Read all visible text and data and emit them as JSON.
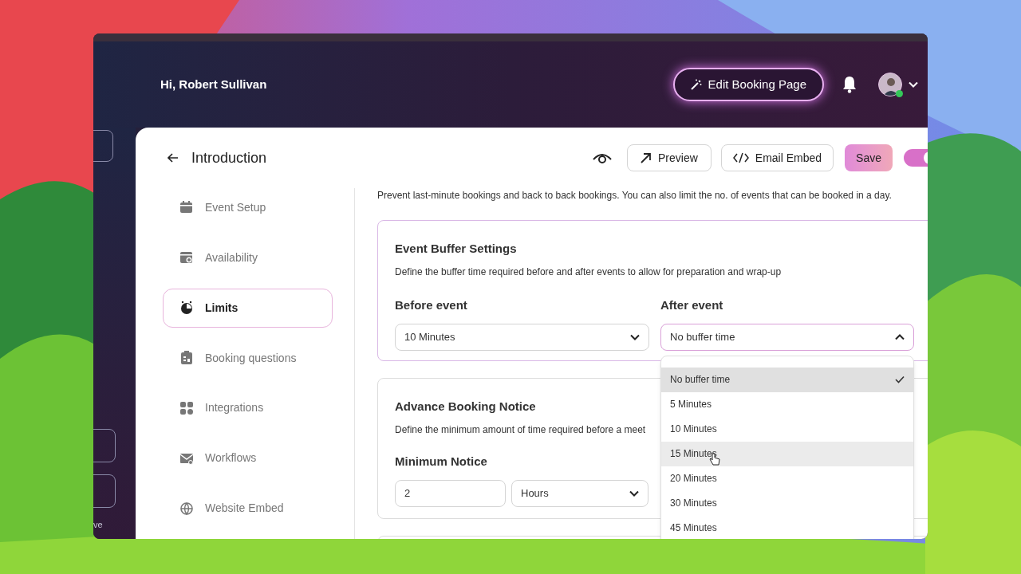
{
  "header": {
    "greeting": "Hi, Robert Sullivan",
    "edit_button": "Edit Booking Page",
    "user_online": true,
    "side_text": "ve"
  },
  "toolbar": {
    "title": "Introduction",
    "preview": "Preview",
    "embed": "Email Embed",
    "save": "Save",
    "toggle_on": true
  },
  "nav": [
    {
      "label": "Event Setup",
      "selected": false
    },
    {
      "label": "Availability",
      "selected": false
    },
    {
      "label": "Limits",
      "selected": true
    },
    {
      "label": "Booking questions",
      "selected": false
    },
    {
      "label": "Integrations",
      "selected": false
    },
    {
      "label": "Workflows",
      "selected": false
    },
    {
      "label": "Website Embed",
      "selected": false
    }
  ],
  "intro": "Prevent last-minute bookings and back to back bookings. You can also limit the no. of events that can be booked in a day.",
  "buffer": {
    "title": "Event Buffer Settings",
    "description": "Define the buffer time required before and after events to allow for preparation and wrap-up",
    "before": {
      "label": "Before event",
      "value": "10 Minutes",
      "open": false
    },
    "after": {
      "label": "After event",
      "value": "No buffer time",
      "open": true,
      "options": [
        {
          "label": "No buffer time",
          "selected": true,
          "hovered": false
        },
        {
          "label": "5 Minutes",
          "selected": false,
          "hovered": false
        },
        {
          "label": "10 Minutes",
          "selected": false,
          "hovered": false
        },
        {
          "label": "15 Minutes",
          "selected": false,
          "hovered": true
        },
        {
          "label": "20 Minutes",
          "selected": false,
          "hovered": false
        },
        {
          "label": "30 Minutes",
          "selected": false,
          "hovered": false
        },
        {
          "label": "45 Minutes",
          "selected": false,
          "hovered": false
        }
      ]
    }
  },
  "advance": {
    "title": "Advance Booking Notice",
    "description": "Define the minimum amount of time required before a meet",
    "label": "Minimum Notice",
    "amount": "2",
    "unit": "Hours"
  }
}
